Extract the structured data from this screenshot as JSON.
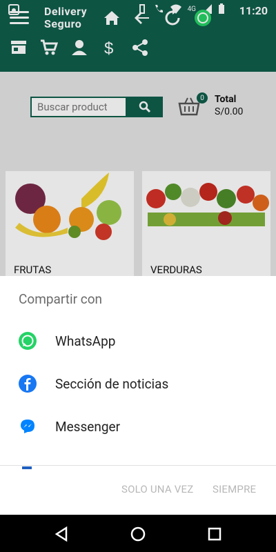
{
  "status_bar": {
    "time": "11:20",
    "network_label": "4G"
  },
  "app": {
    "brand_line1": "Delivery",
    "brand_line2": "Seguro",
    "search": {
      "placeholder": "Buscar product"
    },
    "cart": {
      "badge_count": "0",
      "total_label": "Total",
      "total_value": "S/0.00"
    },
    "categories": [
      {
        "label": "FRUTAS"
      },
      {
        "label": "VERDURAS"
      }
    ]
  },
  "share_sheet": {
    "title": "Compartir con",
    "options": [
      {
        "label": "WhatsApp",
        "icon": "whatsapp-icon",
        "color": "#25D366"
      },
      {
        "label": "Sección de noticias",
        "icon": "facebook-icon",
        "color": "#1877F2"
      },
      {
        "label": "Messenger",
        "icon": "messenger-icon",
        "color": "#0084FF"
      }
    ],
    "buttons": {
      "once": "SOLO UNA VEZ",
      "always": "SIEMPRE"
    }
  },
  "colors": {
    "app_primary": "#0f5e4b",
    "sheet_bg": "#ffffff",
    "disabled_text": "#b7b7b7"
  }
}
